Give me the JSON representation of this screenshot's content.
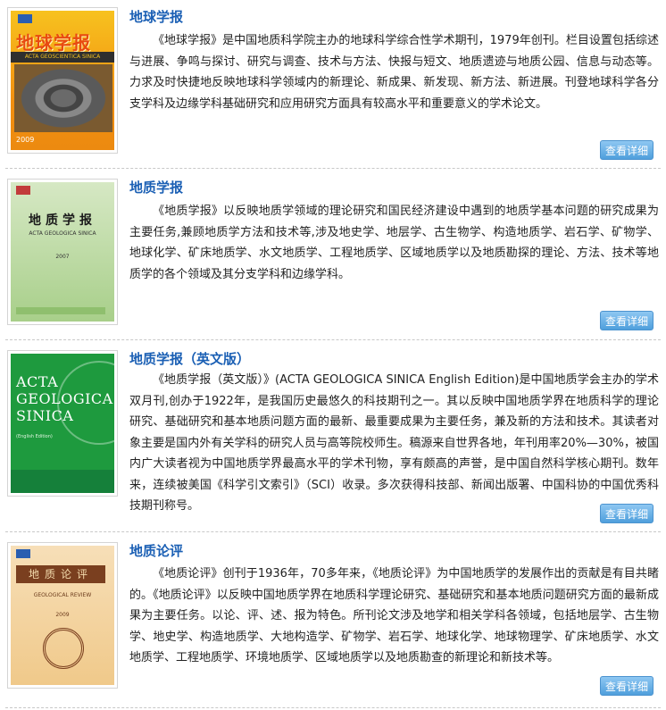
{
  "journals": [
    {
      "title": "地球学报",
      "description": "《地球学报》是中国地质科学院主办的地球科学综合性学术期刊，1979年创刊。栏目设置包括综述与进展、争鸣与探讨、研究与调查、技术与方法、快报与短文、地质遗迹与地质公园、信息与动态等。力求及时快捷地反映地球科学领域内的新理论、新成果、新发现、新方法、新进展。刊登地球科学各分支学科及边缘学科基础研究和应用研究方面具有较高水平和重要意义的学术论文。",
      "button": "查看详细",
      "cover": {
        "title": "地球学报",
        "subtitle": "ACTA GEOSCIENTICA SINICA",
        "year": "2009"
      }
    },
    {
      "title": "地质学报",
      "description": "《地质学报》以反映地质学领域的理论研究和国民经济建设中遇到的地质学基本问题的研究成果为主要任务,兼顾地质学方法和技术等,涉及地史学、地层学、古生物学、构造地质学、岩石学、矿物学、地球化学、矿床地质学、水文地质学、工程地质学、区域地质学以及地质勘探的理论、方法、技术等地质学的各个领域及其分支学科和边缘学科。",
      "button": "查看详细",
      "cover": {
        "title": "地质学报",
        "subtitle": "ACTA GEOLOGICA SINICA",
        "year": "2007"
      }
    },
    {
      "title": "地质学报（英文版）",
      "description": "《地质学报（英文版）》(ACTA GEOLOGICA SINICA English Edition)是中国地质学会主办的学术双月刊,创办于1922年，是我国历史最悠久的科技期刊之一。其以反映中国地质学界在地质科学的理论研究、基础研究和基本地质问题方面的最新、最重要成果为主要任务，兼及新的方法和技术。其读者对象主要是国内外有关学科的研究人员与高等院校师生。稿源来自世界各地，年刊用率20%—30%，被国内广大读者视为中国地质学界最高水平的学术刊物，享有颇高的声誉，是中国自然科学核心期刊。数年来，连续被美国《科学引文索引》（SCI）收录。多次获得科技部、新闻出版署、中国科协的中国优秀科技期刊称号。",
      "button": "查看详细",
      "cover": {
        "title": "ACTA GEOLOGICA SINICA",
        "subtitle": "(English Edition)",
        "year": ""
      }
    },
    {
      "title": "地质论评",
      "description": "《地质论评》创刊于1936年，70多年来，《地质论评》为中国地质学的发展作出的贡献是有目共睹的。《地质论评》以反映中国地质学界在地质科学理论研究、基础研究和基本地质问题研究方面的最新成果为主要任务。以论、评、述、报为特色。所刊论文涉及地学和相关学科各领域，包括地层学、古生物学、地史学、构造地质学、大地构造学、矿物学、岩石学、地球化学、地球物理学、矿床地质学、水文地质学、工程地质学、环境地质学、区域地质学以及地质勘查的新理论和新技术等。",
      "button": "查看详细",
      "cover": {
        "title": "地质论评",
        "subtitle": "GEOLOGICAL REVIEW",
        "year": "2009"
      }
    }
  ]
}
